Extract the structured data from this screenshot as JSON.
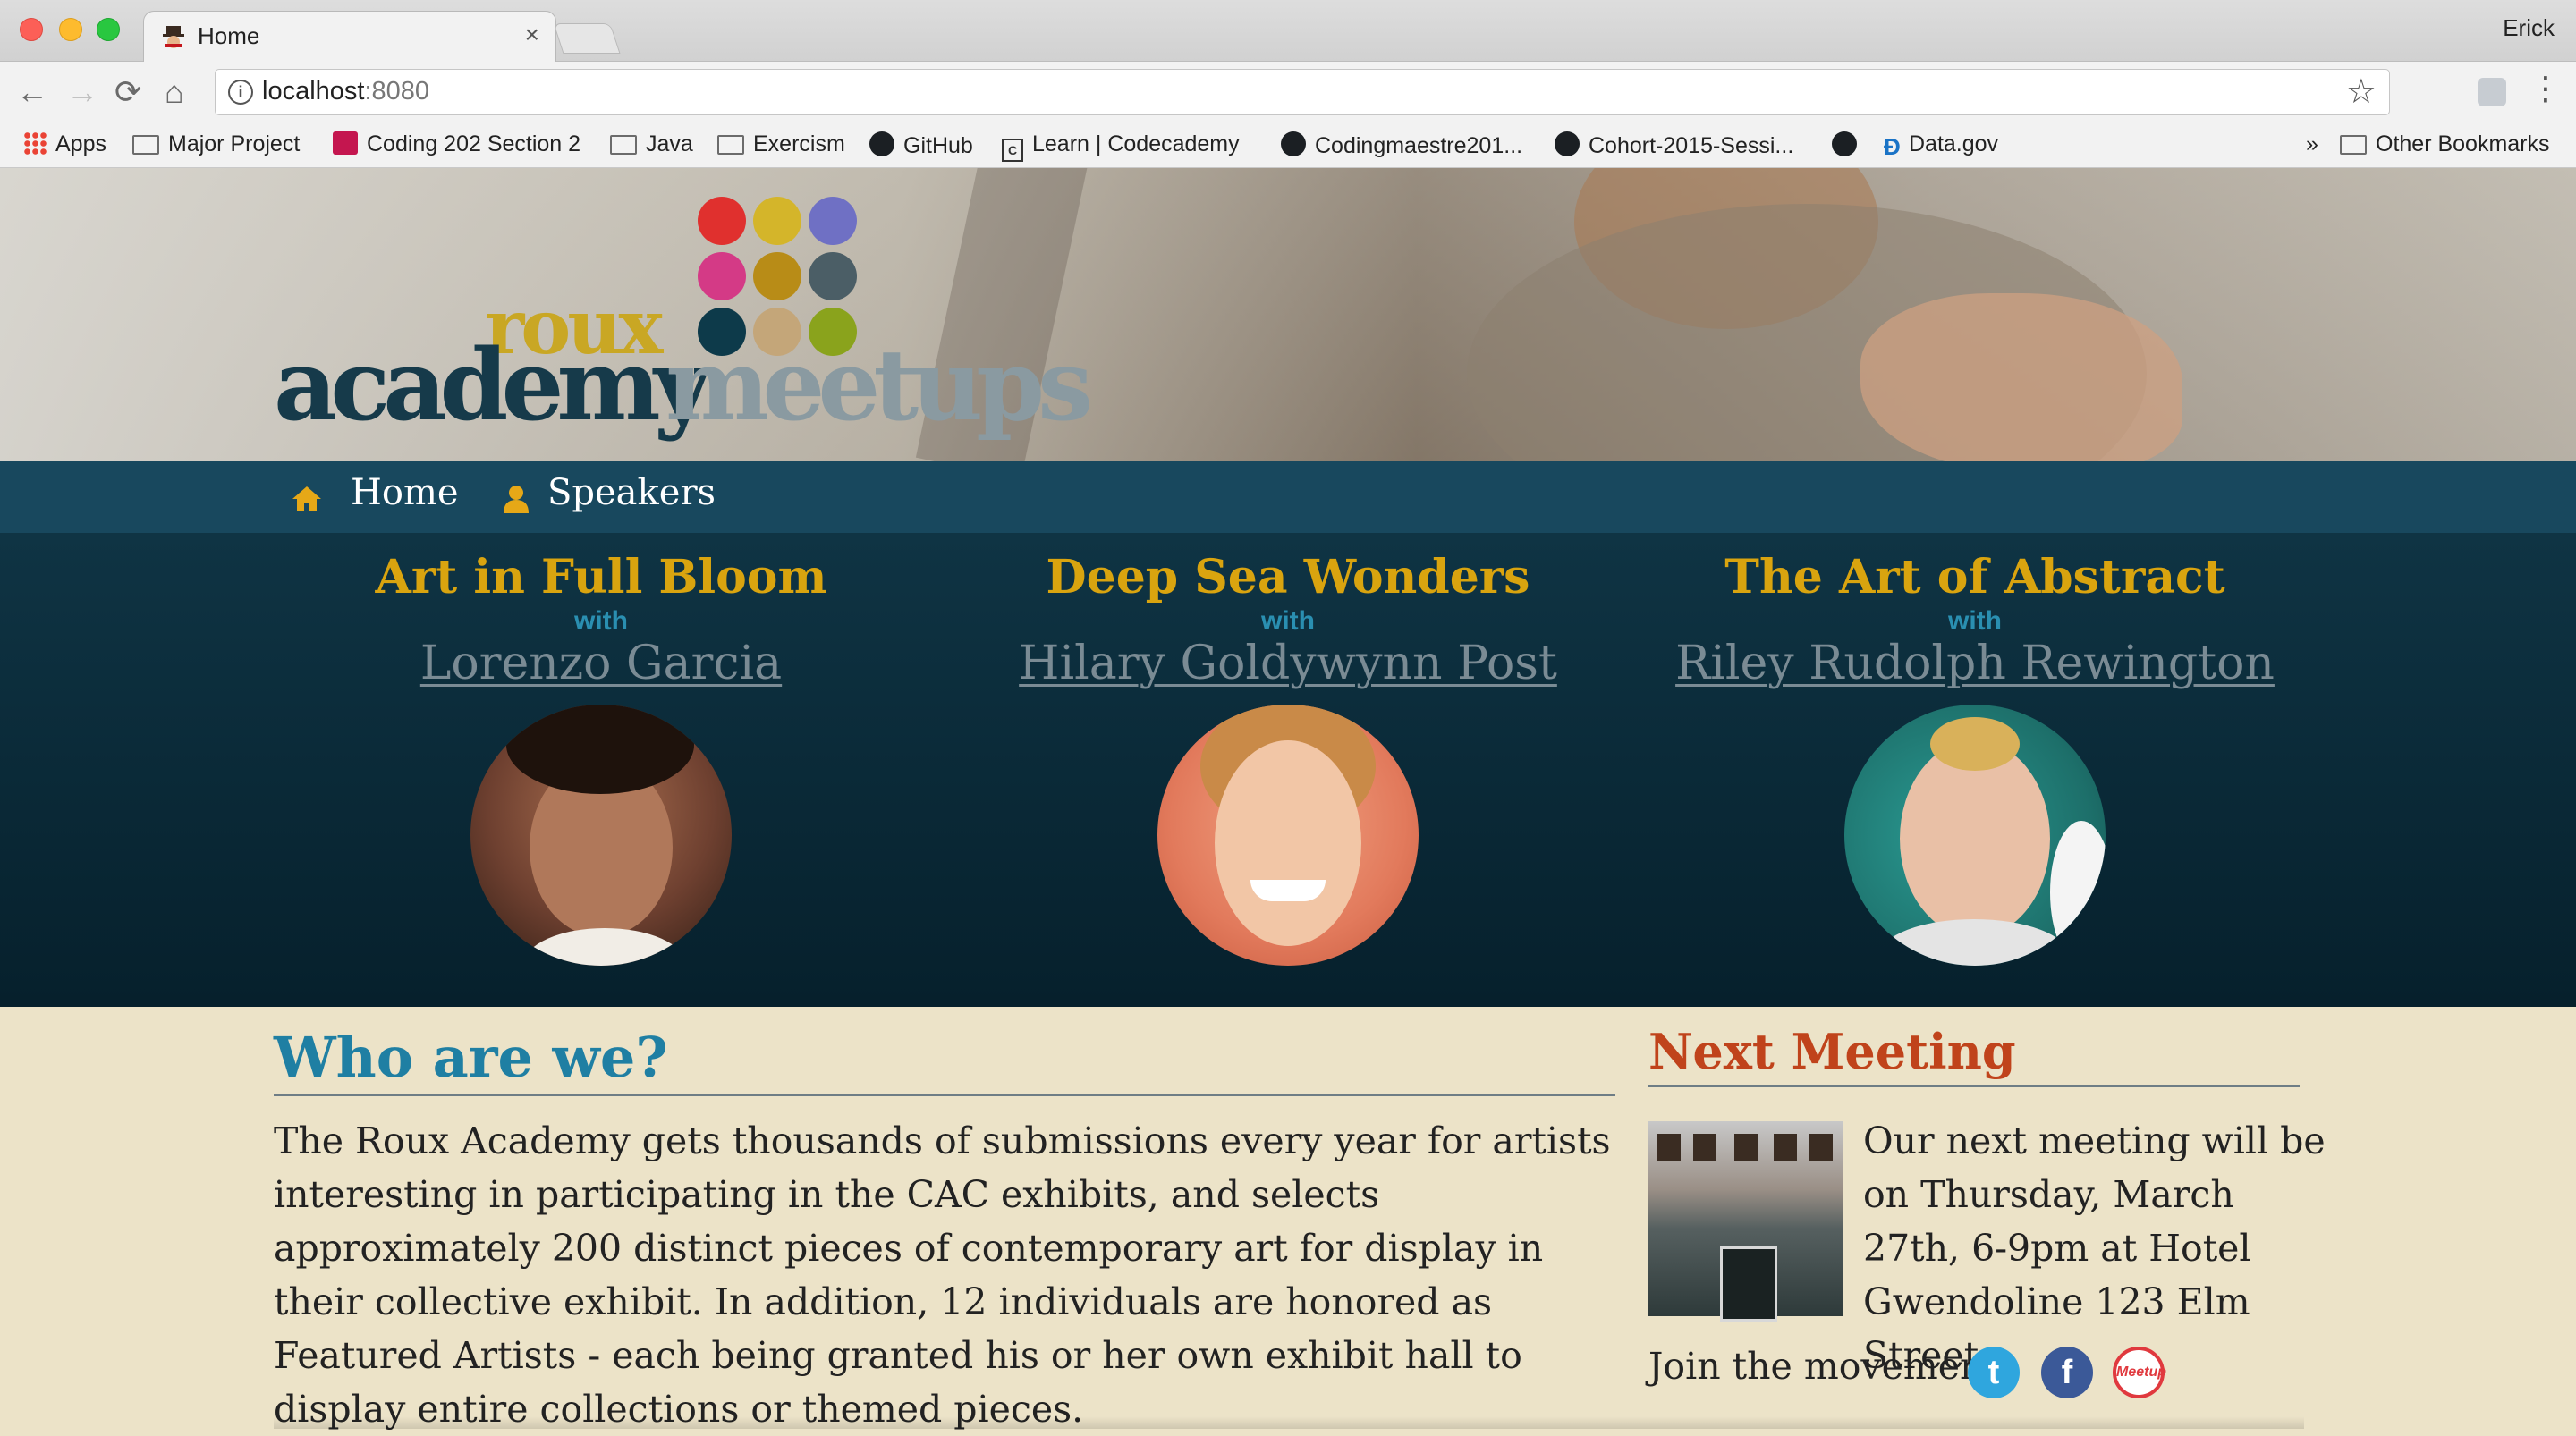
{
  "browser": {
    "tab_title": "Home",
    "tab_close": "×",
    "profile_name": "Erick",
    "url_host": "localhost",
    "url_port": ":8080",
    "nav": {
      "back": "←",
      "forward": "→",
      "reload": "⟳",
      "home": "⌂",
      "star": "☆",
      "menu": "⋮",
      "info": "i"
    },
    "bookmarks": [
      {
        "label": "Apps",
        "icon": "apps-icon"
      },
      {
        "label": "Major Project",
        "icon": "folder-icon"
      },
      {
        "label": "Coding 202 Section 2",
        "icon": "coding202-icon"
      },
      {
        "label": "Java",
        "icon": "folder-icon"
      },
      {
        "label": "Exercism",
        "icon": "folder-icon"
      },
      {
        "label": "GitHub",
        "icon": "github-icon"
      },
      {
        "label": "Learn | Codecademy",
        "icon": "codecademy-icon"
      },
      {
        "label": "Codingmaestre201...",
        "icon": "github-icon"
      },
      {
        "label": "Cohort-2015-Sessi...",
        "icon": "github-icon"
      },
      {
        "label": "Data.gov",
        "icon": "datagov-icon"
      }
    ],
    "overflow": "»",
    "other_bookmarks": "Other Bookmarks"
  },
  "site": {
    "logo": {
      "roux": "roux",
      "academy": "academy",
      "meetups": "meetups"
    },
    "logo_dot_colors": [
      "#e0302e",
      "#d4b52a",
      "#6f70c4",
      "#d43a86",
      "#b88c17",
      "#4b5e66",
      "#0d3a4a",
      "#c4a679",
      "#8aa31c"
    ],
    "nav": [
      {
        "label": "Home",
        "icon": "home-icon"
      },
      {
        "label": "Speakers",
        "icon": "user-icon"
      }
    ],
    "speakers": [
      {
        "title": "Art in Full Bloom",
        "with": "with",
        "name": "Lorenzo Garcia"
      },
      {
        "title": "Deep Sea Wonders",
        "with": "with",
        "name": "Hilary Goldywynn Post"
      },
      {
        "title": "The Art of Abstract",
        "with": "with",
        "name": "Riley Rudolph Rewington"
      }
    ],
    "who": {
      "title": "Who are we?",
      "text": "The Roux Academy gets thousands of submissions every year for artists interesting in participating in the CAC exhibits, and selects approximately 200 distinct pieces of contemporary art for display in their collective exhibit. In addition, 12 individuals are honored as Featured Artists - each being granted his or her own exhibit hall to display entire collections or themed pieces."
    },
    "next_meeting": {
      "title": "Next Meeting",
      "text": "Our next meeting will be on Thursday, March 27th, 6-9pm at Hotel Gwendoline 123 Elm Street",
      "join": "Join the movement:",
      "social": [
        {
          "icon": "twitter-icon",
          "glyph": "t"
        },
        {
          "icon": "facebook-icon",
          "glyph": "f"
        },
        {
          "icon": "meetup-icon",
          "glyph": "Meetup"
        }
      ]
    },
    "colors": {
      "navbar": "#18485e",
      "speaker_title": "#d9a40f",
      "who_title": "#1f7fa3",
      "next_title": "#c0431b",
      "content_bg": "#ece3c8"
    }
  }
}
